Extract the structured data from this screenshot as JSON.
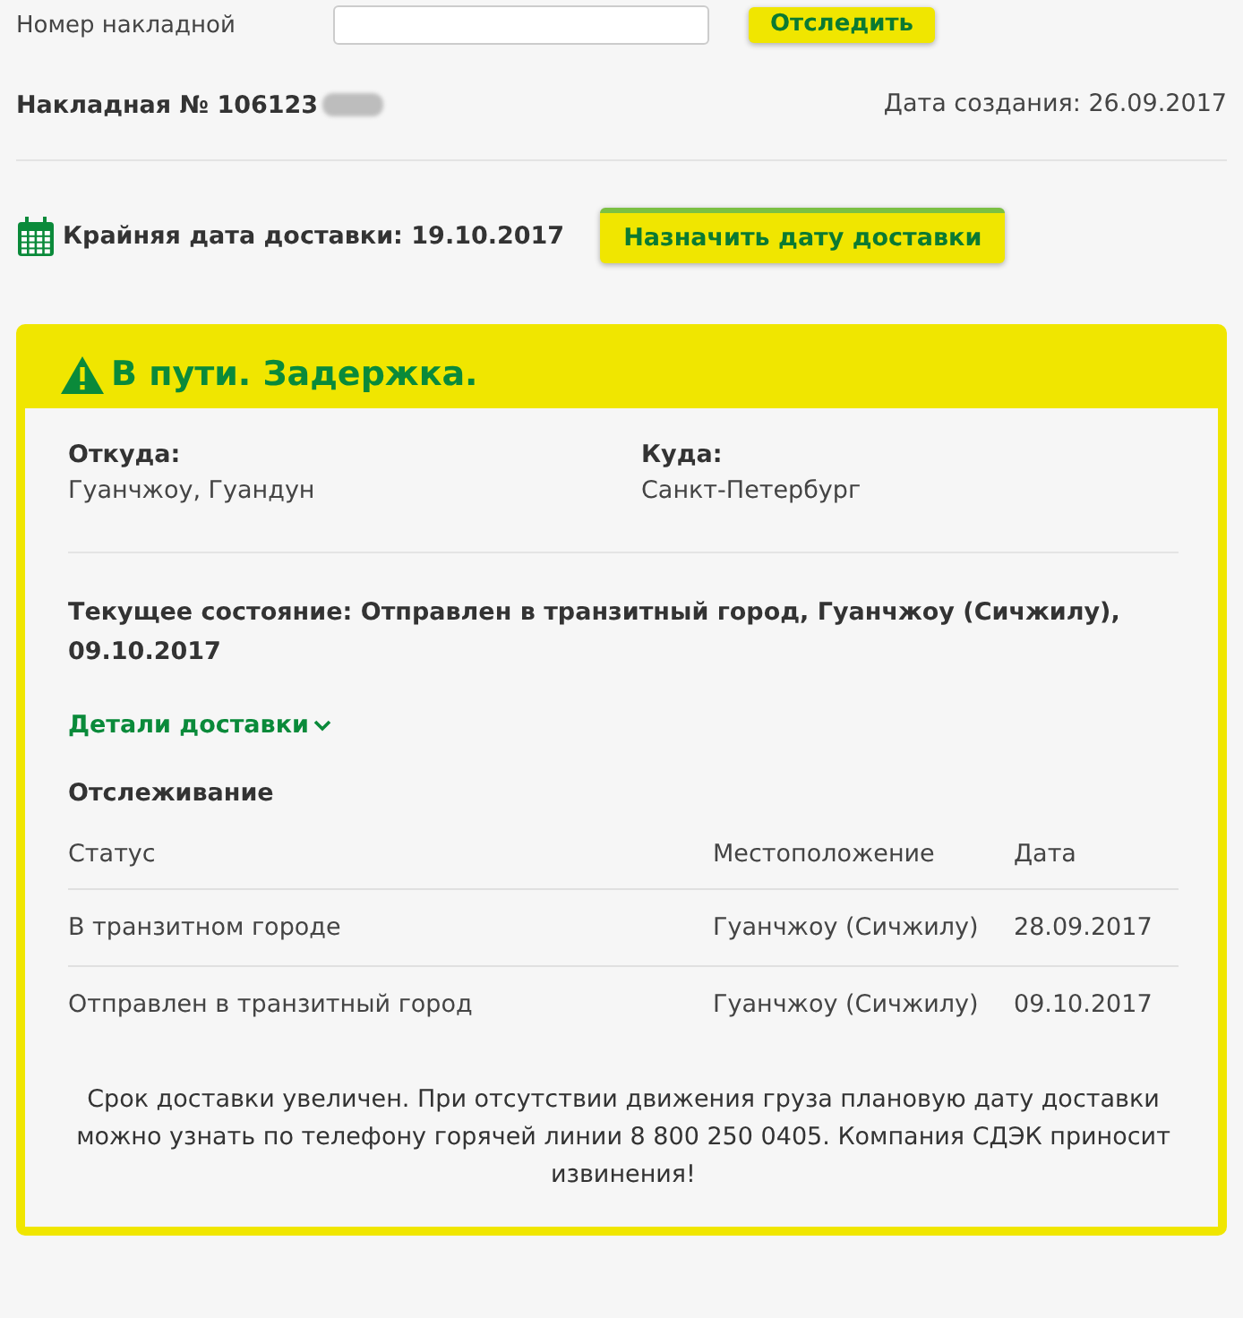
{
  "search": {
    "label": "Номер накладной",
    "button": "Отследить"
  },
  "invoice": {
    "number": "Накладная № 106123",
    "redacted": true,
    "created": "Дата создания: 26.09.2017"
  },
  "deadline": {
    "text": "Крайняя дата доставки: 19.10.2017",
    "button": "Назначить дату доставки"
  },
  "status": {
    "title": "В пути. Задержка.",
    "from_label": "Откуда:",
    "from": "Гуанчжоу, Гуандун",
    "to_label": "Куда:",
    "to": "Санкт-Петербург",
    "current": "Текущее состояние: Отправлен в транзитный город, Гуанчжоу (Сичжилу), 09.10.2017",
    "details_link": "Детали доставки",
    "details_expanded": false,
    "tracking_title": "Отслеживание",
    "columns": [
      "Статус",
      "Местоположение",
      "Дата"
    ],
    "rows": [
      [
        "В транзитном городе",
        "Гуанчжоу (Сичжилу)",
        "28.09.2017"
      ],
      [
        "Отправлен в транзитный город",
        "Гуанчжоу (Сичжилу)",
        "09.10.2017"
      ]
    ],
    "note": "Срок доставки увеличен. При отсутствии движения груза плановую дату доставки можно узнать по телефону горячей линии 8 800 250 0405. Компания СДЭК приносит извинения!"
  }
}
